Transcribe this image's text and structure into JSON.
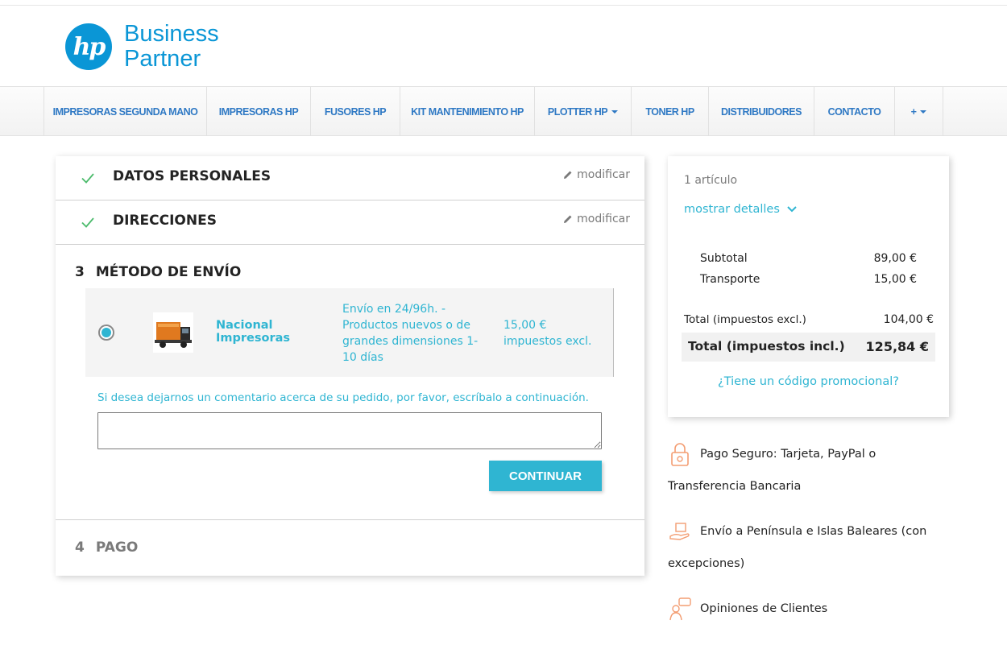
{
  "brand": {
    "logo_mark": "hp",
    "name_line1": "Business",
    "name_line2": "Partner",
    "color": "#0a96d6"
  },
  "nav": {
    "items": [
      {
        "label": "IMPRESORAS SEGUNDA MANO",
        "dropdown": false
      },
      {
        "label": "IMPRESORAS HP",
        "dropdown": false
      },
      {
        "label": "FUSORES HP",
        "dropdown": false
      },
      {
        "label": "KIT MANTENIMIENTO HP",
        "dropdown": false
      },
      {
        "label": "PLOTTER HP",
        "dropdown": true
      },
      {
        "label": "TONER HP",
        "dropdown": false
      },
      {
        "label": "DISTRIBUIDORES",
        "dropdown": false
      },
      {
        "label": "CONTACTO",
        "dropdown": false
      },
      {
        "label": "+",
        "dropdown": true
      }
    ]
  },
  "checkout": {
    "step1": {
      "title": "DATOS PERSONALES",
      "modify": "modificar",
      "status": "complete"
    },
    "step2": {
      "title": "DIRECCIONES",
      "modify": "modificar",
      "status": "complete"
    },
    "step3": {
      "number": "3",
      "title": "MÉTODO DE ENVÍO",
      "carrier": {
        "selected": true,
        "name": "Nacional Impresoras",
        "delay": "Envío en 24/96h. - Productos nuevos o de grandes dimensiones 1-10 días",
        "price": "15,00 € impuestos excl.",
        "logo_icon": "truck-icon"
      },
      "comment_label": "Si desea dejarnos un comentario acerca de su pedido, por favor, escríbalo a continuación.",
      "comment_value": "",
      "continue_label": "CONTINUAR"
    },
    "step4": {
      "number": "4",
      "title": "PAGO"
    }
  },
  "summary": {
    "item_count": "1 artículo",
    "show_details": "mostrar detalles",
    "subtotal_label": "Subtotal",
    "subtotal_value": "89,00 €",
    "shipping_label": "Transporte",
    "shipping_value": "15,00 €",
    "total_excl_label": "Total (impuestos excl.)",
    "total_excl_value": "104,00 €",
    "total_incl_label": "Total (impuestos incl.)",
    "total_incl_value": "125,84 €",
    "promo_link": "¿Tiene un código promocional?"
  },
  "reassurance": [
    {
      "icon": "lock-icon",
      "text": "Pago Seguro: Tarjeta, PayPal o Transferencia Bancaria"
    },
    {
      "icon": "delivery-box-icon",
      "text": "Envío a Península e Islas Baleares (con excepciones)"
    },
    {
      "icon": "customer-chat-icon",
      "text": "Opiniones de Clientes"
    }
  ],
  "colors": {
    "accent": "#2fb5d2",
    "nav_link": "#2f79c4",
    "check": "#4cbb6c",
    "icon_orange": "#f39d72"
  }
}
